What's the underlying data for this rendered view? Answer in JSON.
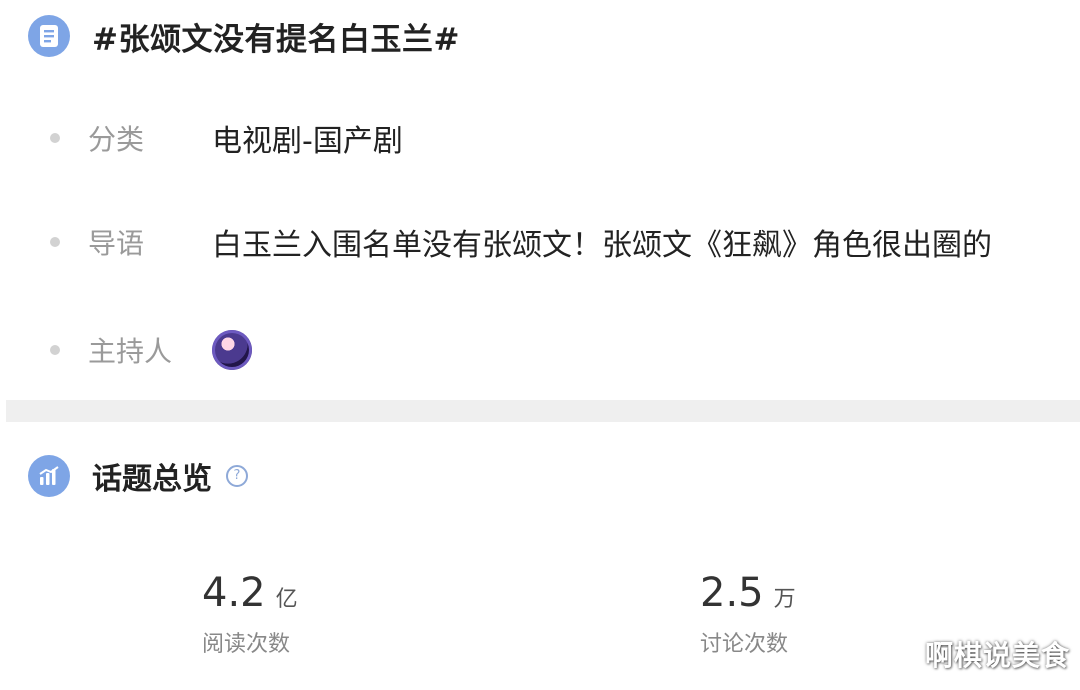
{
  "topic": {
    "title": "#张颂文没有提名白玉兰#",
    "category_label": "分类",
    "category_value": "电视剧-国产剧",
    "intro_label": "导语",
    "intro_value": "白玉兰入围名单没有张颂文！张颂文《狂飙》角色很出圈的",
    "host_label": "主持人"
  },
  "overview": {
    "title": "话题总览",
    "help_icon": "?",
    "stats": [
      {
        "number": "4.2",
        "unit": "亿",
        "label": "阅读次数"
      },
      {
        "number": "2.5",
        "unit": "万",
        "label": "讨论次数"
      }
    ]
  },
  "watermark": "啊棋说美食",
  "colors": {
    "accent_icon": "#7ea5e6",
    "divider": "#efefef",
    "label_gray": "#9a9a9a"
  },
  "icons": {
    "title_icon": "document-list-icon",
    "section_icon": "bar-chart-icon",
    "help": "question-circle-icon",
    "host": "host-avatar"
  }
}
